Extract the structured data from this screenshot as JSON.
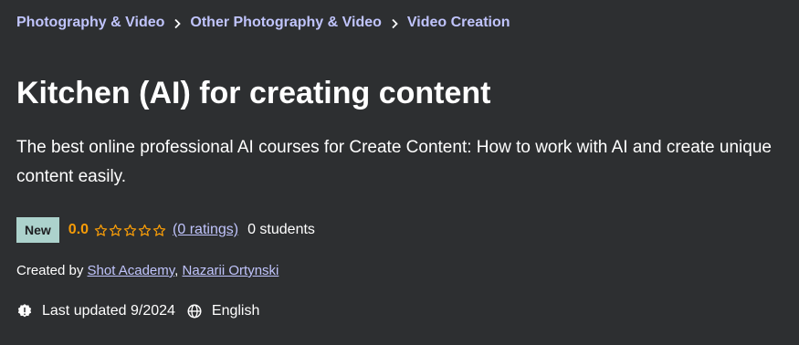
{
  "breadcrumb": [
    {
      "label": "Photography & Video"
    },
    {
      "label": "Other Photography & Video"
    },
    {
      "label": "Video Creation"
    }
  ],
  "course": {
    "title": "Kitchen (AI) for creating content",
    "subtitle": "The best online professional AI courses for Create Content: How to work with AI and create unique content easily."
  },
  "rating": {
    "badge": "New",
    "score": "0.0",
    "stars_filled": 0,
    "stars_total": 5,
    "ratings_text": "(0 ratings)",
    "students_text": "0 students"
  },
  "creators": {
    "prefix": "Created by",
    "separator": ",",
    "authors": [
      "Shot Academy",
      "Nazarii Ortynski"
    ]
  },
  "meta": {
    "updated_text": "Last updated 9/2024",
    "language": "English",
    "updated_icon": "alert-badge-icon",
    "language_icon": "globe-icon"
  },
  "colors": {
    "background": "#2d2f31",
    "link": "#c0c4fc",
    "badge_bg": "#acd2cc",
    "rating": "#f69c08"
  }
}
